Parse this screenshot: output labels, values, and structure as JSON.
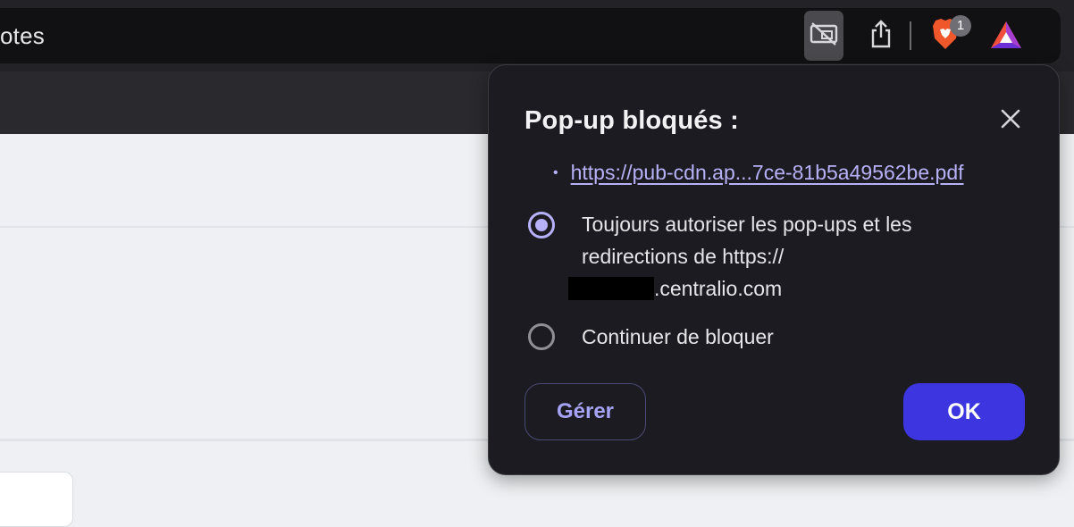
{
  "browser": {
    "address_text": "otes",
    "popup_blocked_icon": "popup-blocked-icon",
    "share_icon": "share-icon",
    "shields_icon": "brave-shields-icon",
    "shields_badge": "1",
    "rewards_icon": "brave-rewards-icon"
  },
  "dialog": {
    "title": "Pop-up bloqués :",
    "close_icon": "close-icon",
    "blocked_link": "https://pub-cdn.ap...7ce-81b5a49562be.pdf",
    "bullet": "•",
    "options": [
      {
        "line1": "Toujours autoriser les pop-ups et les",
        "line2": "redirections de https://",
        "line3_suffix": ".centralio.com",
        "selected": true
      },
      {
        "line1": "Continuer de bloquer",
        "selected": false
      }
    ],
    "manage_label": "Gérer",
    "ok_label": "OK"
  },
  "colors": {
    "accent": "#3d36e0",
    "link": "#b7b1f8",
    "dialog_bg": "#1c1b22"
  }
}
